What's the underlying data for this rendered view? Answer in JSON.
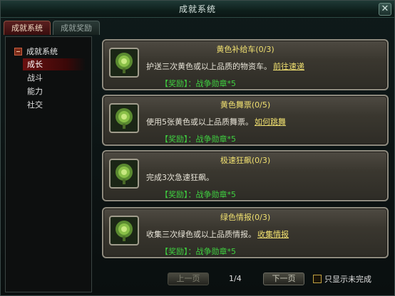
{
  "window": {
    "title": "成就系统"
  },
  "tabs": [
    {
      "label": "成就系统",
      "active": true
    },
    {
      "label": "成就奖励",
      "active": false
    }
  ],
  "sidebar": {
    "root": "成就系统",
    "items": [
      {
        "label": "成长",
        "selected": true
      },
      {
        "label": "战斗",
        "selected": false
      },
      {
        "label": "能力",
        "selected": false
      },
      {
        "label": "社交",
        "selected": false
      }
    ]
  },
  "achievements": [
    {
      "icon": "green-seal-icon",
      "title": "黄色补给车(0/3)",
      "desc": "护送三次黄色或以上品质的物资车。",
      "link": "前往速递",
      "reward": "【奖励】：战争勋章*5"
    },
    {
      "icon": "green-seal-icon",
      "title": "黄色舞票(0/5)",
      "desc": "使用5张黄色或以上品质舞票。",
      "link": "如何跳舞",
      "reward": "【奖励】：战争勋章*5"
    },
    {
      "icon": "green-seal-icon",
      "title": "极速狂飙(0/3)",
      "desc": "完成3次急速狂飙。",
      "link": "",
      "reward": "【奖励】：战争勋章*5"
    },
    {
      "icon": "green-seal-icon",
      "title": "绿色情报(0/3)",
      "desc": "收集三次绿色或以上品质情报。",
      "link": "收集情报",
      "reward": "【奖励】：战争勋章*5"
    }
  ],
  "pager": {
    "prev": "上一页",
    "next": "下一页",
    "page": "1/4",
    "filter_label": "只显示未完成"
  },
  "colors": {
    "title_yellow": "#f0e070",
    "reward_green": "#3fd040",
    "selected_red": "#6a1010"
  }
}
